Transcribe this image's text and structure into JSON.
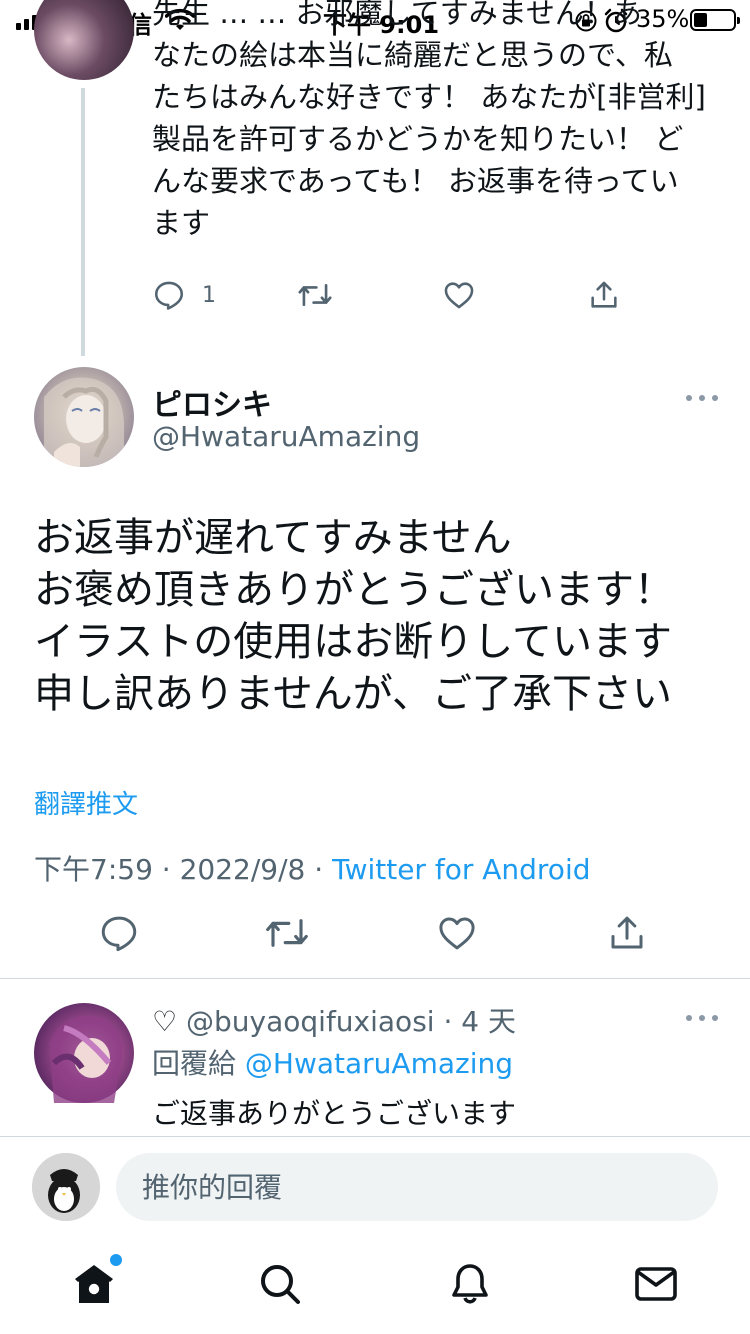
{
  "status_bar": {
    "carrier": "遠傳電信",
    "time": "下午 9:01",
    "battery": "35%",
    "battery_level": 0.35
  },
  "parent_tweet": {
    "partial_line": "先生 … … お邪魔してすみません！あ",
    "lines": [
      "なたの絵は本当に綺麗だと思うので、私",
      "たちはみんな好きです！ あなたが[非営利]",
      "製品を許可するかどうかを知りたい！ ど",
      "んな要求であっても！ お返事を待ってい",
      "ます"
    ],
    "reply_count": "1",
    "icons": [
      "reply-icon",
      "retweet-icon",
      "like-icon",
      "share-icon"
    ]
  },
  "main_tweet": {
    "name": "ピロシキ",
    "handle": "@HwataruAmazing",
    "body_lines": [
      "お返事が遅れてすみません",
      "お褒め頂きありがとうございます！",
      "イラストの使用はお断りしています",
      "申し訳ありませんが、ご了承下さい"
    ],
    "translate": "翻譯推文",
    "time": "下午7:59",
    "date": "2022/9/8",
    "separator": "·",
    "source": "Twitter for Android"
  },
  "reply": {
    "heart": "♡",
    "handle": "@buyaoqifuxiaosi",
    "dot": "·",
    "age": "4 天",
    "replying_to_label": "回覆給",
    "replying_to": "@HwataruAmazing",
    "text": "ご返事ありがとうございます"
  },
  "composer": {
    "placeholder": "推你的回覆"
  },
  "tab_bar": {
    "items": [
      "home-icon",
      "search-icon",
      "notifications-icon",
      "messages-icon"
    ]
  },
  "colors": {
    "accent": "#1d9bf0",
    "text": "#0f1419",
    "secondary": "#536471",
    "divider": "#cfd9de"
  }
}
